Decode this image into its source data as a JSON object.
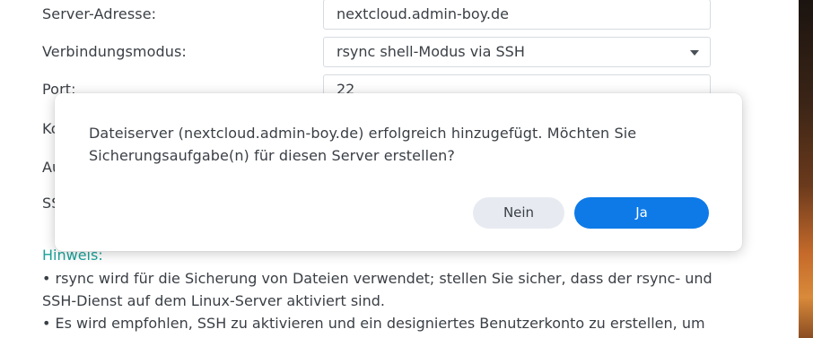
{
  "form": {
    "server_label": "Server-Adresse:",
    "server_value": "nextcloud.admin-boy.de",
    "mode_label": "Verbindungsmodus:",
    "mode_value": "rsync shell-Modus via SSH",
    "port_label": "Port:",
    "port_value": "22",
    "hidden_label_1": "Ko",
    "hidden_label_2": "Au",
    "hidden_label_3": "SS"
  },
  "hint": {
    "title": "Hinweis:",
    "bullet_1": "• rsync wird für die Sicherung von Dateien verwendet; stellen Sie sicher, dass der rsync- und SSH-Dienst auf dem Linux-Server aktiviert sind.",
    "bullet_2": "• Es wird empfohlen, SSH zu aktivieren und ein designiertes Benutzerkonto zu erstellen, um"
  },
  "dialog": {
    "message": "Dateiserver (nextcloud.admin-boy.de) erfolgreich hinzugefügt. Möchten Sie Sicherungsaufgabe(n) für diesen Server erstellen?",
    "no_label": "Nein",
    "yes_label": "Ja"
  },
  "colors": {
    "primary": "#0d7ae8",
    "hint": "#1aa39a",
    "secondary_button": "#e7ebf1"
  }
}
